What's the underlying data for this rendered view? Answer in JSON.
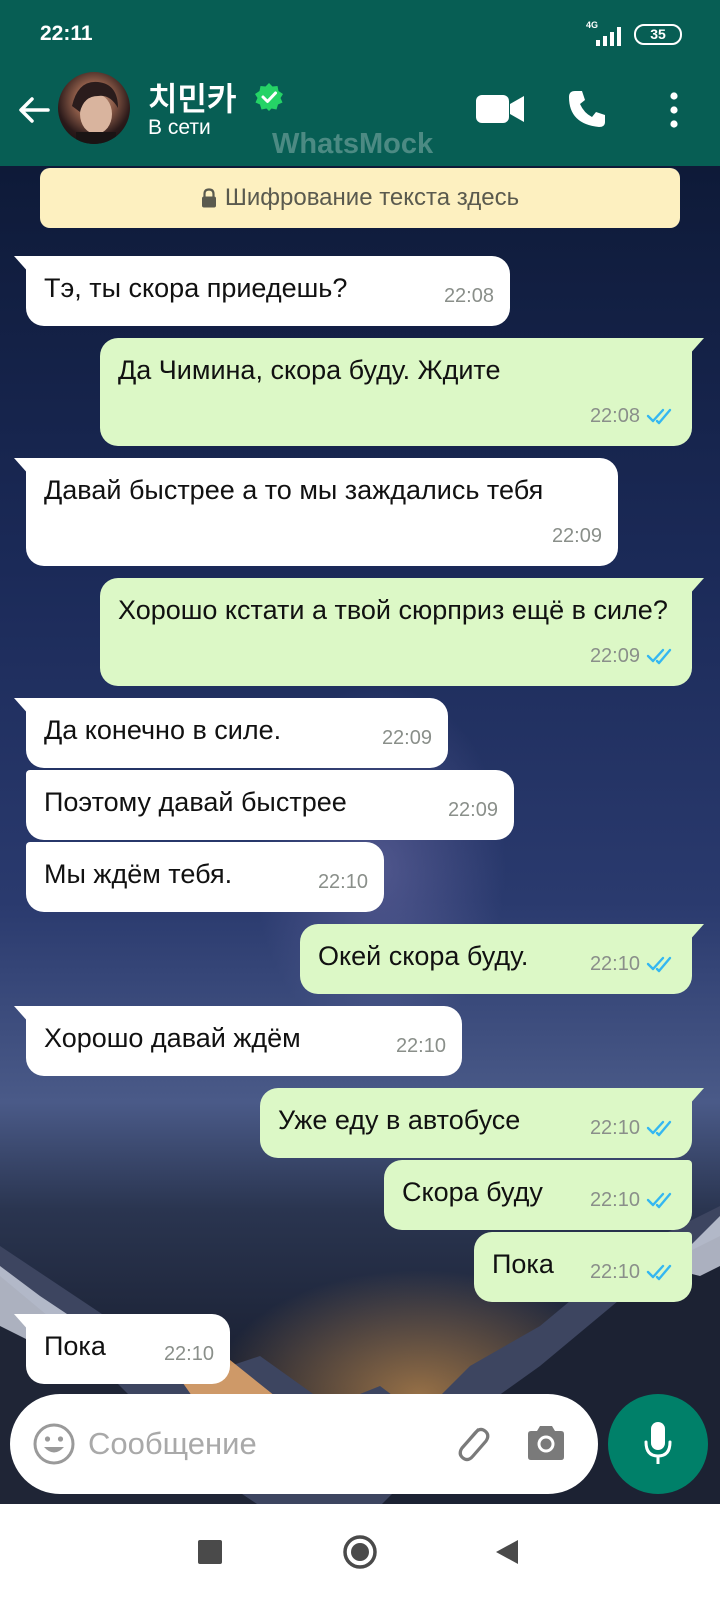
{
  "status_bar": {
    "time": "22:11",
    "network": "4G",
    "battery": "35"
  },
  "header": {
    "contact_name": "치민카",
    "contact_status": "В сети",
    "watermark": "WhatsMock"
  },
  "encryption_banner": "Шифрование текста здесь",
  "messages": [
    {
      "dir": "in",
      "text": "Тэ, ты скора приедешь?",
      "time": "22:08"
    },
    {
      "dir": "out",
      "text": "Да Чимина, скора буду. Ждите",
      "time": "22:08",
      "read": true
    },
    {
      "dir": "in",
      "text": "Давай быстрее а то мы заждались тебя",
      "time": "22:09"
    },
    {
      "dir": "out",
      "text": "Хорошо кстати а твой сюрприз ещё в силе?",
      "time": "22:09",
      "read": true
    },
    {
      "dir": "in",
      "text": "Да конечно в силе.",
      "time": "22:09"
    },
    {
      "dir": "in",
      "text": "Поэтому давай быстрее",
      "time": "22:09"
    },
    {
      "dir": "in",
      "text": "Мы ждём тебя.",
      "time": "22:10"
    },
    {
      "dir": "out",
      "text": "Окей скора буду.",
      "time": "22:10",
      "read": true
    },
    {
      "dir": "in",
      "text": "Хорошо давай ждём",
      "time": "22:10"
    },
    {
      "dir": "out",
      "text": "Уже еду в автобусе",
      "time": "22:10",
      "read": true
    },
    {
      "dir": "out",
      "text": "Скора буду",
      "time": "22:10",
      "read": true
    },
    {
      "dir": "out",
      "text": "Пока",
      "time": "22:10",
      "read": true
    },
    {
      "dir": "in",
      "text": "Пока",
      "time": "22:10"
    }
  ],
  "input": {
    "placeholder": "Сообщение",
    "value": ""
  },
  "colors": {
    "header": "#075e54",
    "outgoing": "#dcf8c6",
    "incoming": "#ffffff",
    "read_check": "#34b7f1",
    "mic_button": "#008069"
  },
  "icons": [
    "back-arrow-icon",
    "verified-icon",
    "video-call-icon",
    "phone-icon",
    "more-menu-icon",
    "lock-icon",
    "double-check-icon",
    "emoji-icon",
    "attach-icon",
    "camera-icon",
    "mic-icon"
  ]
}
